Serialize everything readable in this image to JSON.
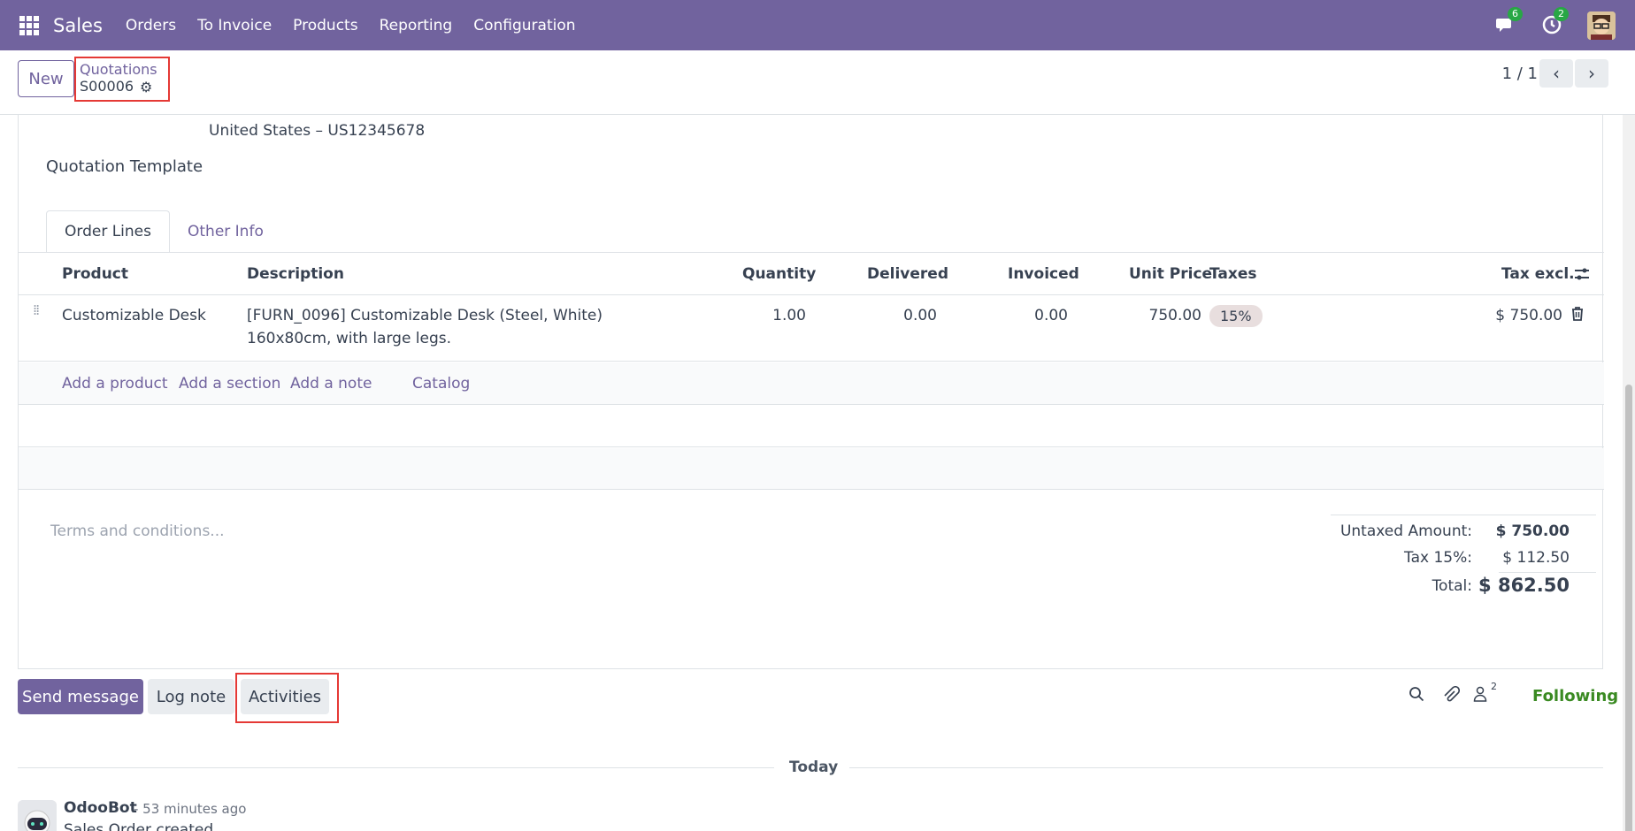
{
  "topbar": {
    "app_name": "Sales",
    "menu": [
      "Orders",
      "To Invoice",
      "Products",
      "Reporting",
      "Configuration"
    ],
    "messages_count": "6",
    "activities_count": "2"
  },
  "control": {
    "new_label": "New",
    "breadcrumb_parent": "Quotations",
    "record_name": "S00006",
    "pager": "1 / 1"
  },
  "form": {
    "vat_line": "United States – US12345678",
    "quotation_template_label": "Quotation Template",
    "tabs": [
      "Order Lines",
      "Other Info"
    ]
  },
  "table": {
    "headers": {
      "product": "Product",
      "description": "Description",
      "quantity": "Quantity",
      "delivered": "Delivered",
      "invoiced": "Invoiced",
      "unit_price": "Unit Price",
      "taxes": "Taxes",
      "tax_excl": "Tax excl."
    },
    "rows": [
      {
        "product": "Customizable Desk",
        "description_line1": "[FURN_0096] Customizable Desk (Steel, White)",
        "description_line2": "160x80cm, with large legs.",
        "quantity": "1.00",
        "delivered": "0.00",
        "invoiced": "0.00",
        "unit_price": "750.00",
        "taxes": "15%",
        "tax_excl": "$ 750.00"
      }
    ],
    "add_links": {
      "product": "Add a product",
      "section": "Add a section",
      "note": "Add a note",
      "catalog": "Catalog"
    }
  },
  "terms_placeholder": "Terms and conditions...",
  "totals": {
    "untaxed_label": "Untaxed Amount:",
    "untaxed_value": "$ 750.00",
    "tax_label": "Tax 15%:",
    "tax_value": "$ 112.50",
    "total_label": "Total:",
    "total_value": "$ 862.50"
  },
  "chatter": {
    "send_message": "Send message",
    "log_note": "Log note",
    "activities": "Activities",
    "followers_count": "2",
    "following": "Following",
    "day_separator": "Today",
    "message": {
      "author": "OdooBot",
      "time": "- 53 minutes ago",
      "body": "Sales Order created"
    }
  },
  "colors": {
    "brand": "#71639e",
    "highlight_outline": "#e53935",
    "following": "#3a8a22",
    "badge": "#28a745"
  }
}
